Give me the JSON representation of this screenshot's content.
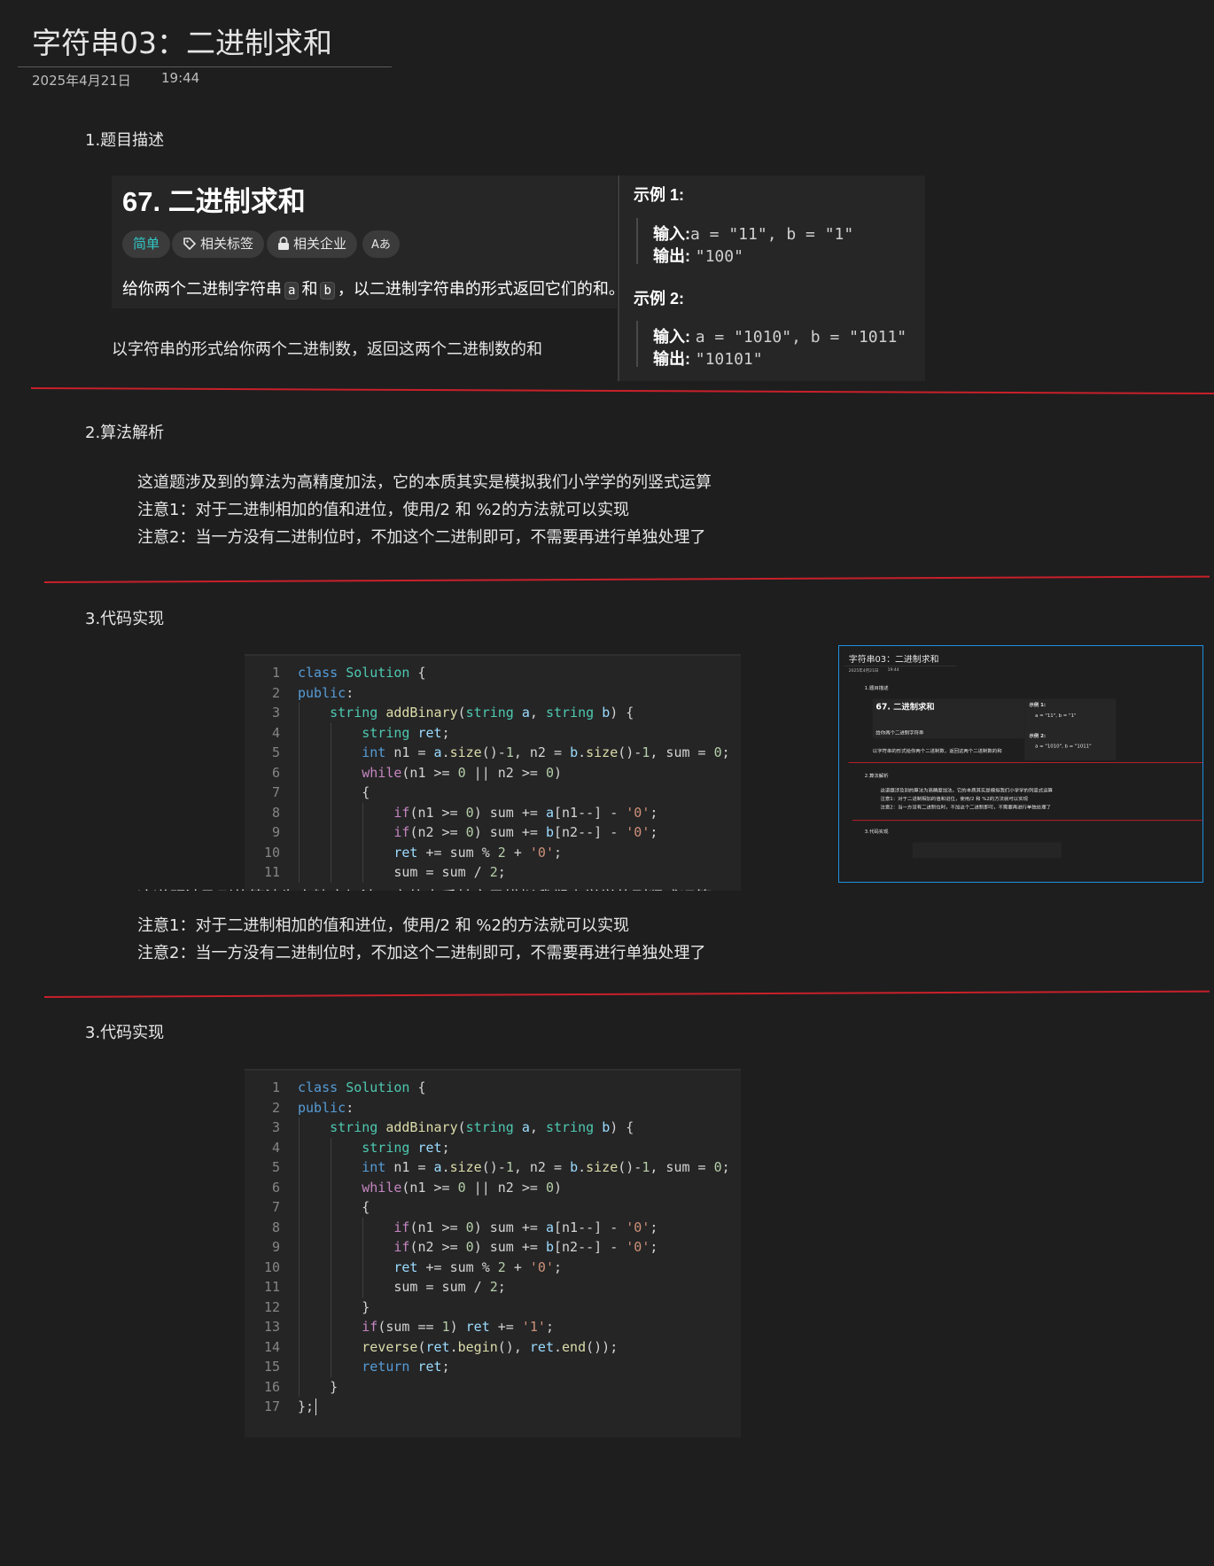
{
  "page": {
    "title": "字符串03：二进制求和",
    "date": "2025年4月21日",
    "time": "19:44"
  },
  "sections": {
    "s1": "1.题目描述",
    "s2": "2.算法解析",
    "s3": "3.代码实现"
  },
  "problem": {
    "title": "67. 二进制求和",
    "tags": [
      "简单",
      "相关标签",
      "相关企业",
      "Aあ"
    ],
    "desc_before": "给你两个二进制字符串",
    "var_a": "a",
    "desc_and": "和",
    "var_b": "b",
    "desc_after": "，以二进制字符串的形式返回它们的和。",
    "caption": "以字符串的形式给你两个二进制数，返回这两个二进制数的和",
    "examples": [
      {
        "title": "示例 1:",
        "input_label": "输入:",
        "input": "a = \"11\", b = \"1\"",
        "output_label": "输出:",
        "output": "\"100\""
      },
      {
        "title": "示例 2:",
        "input_label": "输入:",
        "input": "a = \"1010\", b = \"1011\"",
        "output_label": "输出:",
        "output": "\"10101\""
      }
    ]
  },
  "analysis": [
    "这道题涉及到的算法为高精度加法，它的本质其实是模拟我们小学学的列竖式运算",
    "注意1：对于二进制相加的值和进位，使用/2 和 %2的方法就可以实现",
    "注意2：当一方没有二进制位时，不加这个二进制即可，不需要再进行单独处理了"
  ],
  "code": {
    "line_numbers": [
      "1",
      "2",
      "3",
      "4",
      "5",
      "6",
      "7",
      "8",
      "9",
      "10",
      "11",
      "12",
      "13",
      "14",
      "15",
      "16",
      "17"
    ],
    "lines": [
      "class Solution {",
      "public:",
      "    string addBinary(string a, string b) {",
      "        string ret;",
      "        int n1 = a.size()-1, n2 = b.size()-1, sum = 0;",
      "        while(n1 >= 0 || n2 >= 0)",
      "        {",
      "            if(n1 >= 0) sum += a[n1--] - '0';",
      "            if(n2 >= 0) sum += b[n2--] - '0';",
      "            ret += sum % 2 + '0';",
      "            sum = sum / 2;",
      "        }",
      "        if(sum == 1) ret += '1';",
      "        reverse(ret.begin(), ret.end());",
      "        return ret;",
      "    }",
      "};"
    ]
  },
  "colors": {
    "background": "#1e1e1e",
    "divider": "#c8202a",
    "thumbnail_border": "#1e90e0",
    "tag_easy": "#32c6c6"
  }
}
